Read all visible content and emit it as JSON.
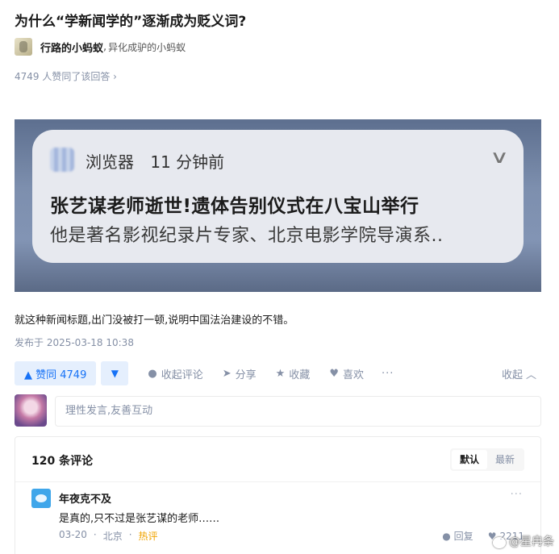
{
  "question": {
    "title": "为什么“学新闻学的”逐渐成为贬义词?"
  },
  "author": {
    "name": "行路的小蚂蚁",
    "separator": ",",
    "bio": "异化成驴的小蚂蚁"
  },
  "answer_meta": {
    "vote_summary": "4749 人赞同了该回答 ›"
  },
  "notification": {
    "app_name": "浏览器",
    "time_ago": "11 分钟前",
    "chevron": "∨",
    "headline": "张艺谋老师逝世!遗体告别仪式在八宝山举行",
    "body": "他是著名影视纪录片专家、北京电影学院导演系.."
  },
  "answer": {
    "text": "就这种新闻标题,出门没被打一顿,说明中国法治建设的不错。",
    "published": "发布于 2025-03-18 10:38"
  },
  "actions": {
    "vote_up": "▲ 赞同 4749",
    "vote_down": "▼",
    "collapse_comments": "收起评论",
    "share": "分享",
    "favorite": "收藏",
    "like": "喜欢",
    "more": "···",
    "collapse": "收起"
  },
  "comment_input": {
    "placeholder": "理性发言,友善互动"
  },
  "comments": {
    "count_label": "120 条评论",
    "sort_default": "默认",
    "sort_latest": "最新",
    "items": [
      {
        "user": "年夜克不及",
        "text": "是真的,只不过是张艺谋的老师……",
        "date": "03-20",
        "dot": "·",
        "location": "北京",
        "tag": "热评",
        "reply": "回复",
        "likes": "2211",
        "more": "···"
      }
    ]
  },
  "watermark": {
    "text": "@星冉条"
  },
  "icons": {
    "comment": "comment-icon",
    "share": "share-icon",
    "favorite": "star-icon",
    "like": "heart-icon",
    "collapse": "chevron-up-icon"
  }
}
